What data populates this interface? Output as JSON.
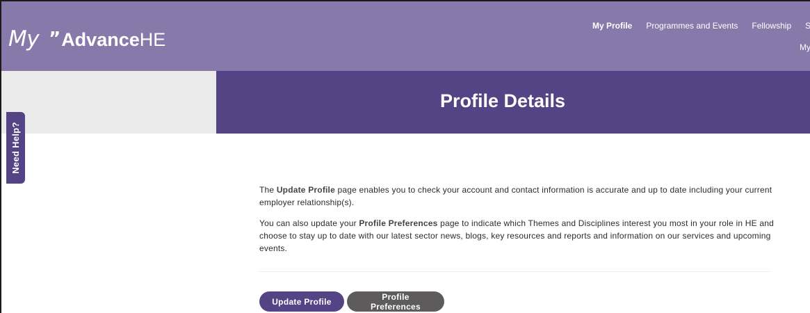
{
  "header": {
    "logo": {
      "my": "My",
      "quote": "”",
      "advance": "Advance",
      "he": "HE"
    },
    "nav": [
      {
        "label": "My Profile",
        "active": true
      },
      {
        "label": "Programmes and Events",
        "active": false
      },
      {
        "label": "Fellowship",
        "active": false
      },
      {
        "label": "S",
        "active": false
      }
    ],
    "nav_second_row": "My"
  },
  "banner": {
    "title": "Profile Details"
  },
  "help_tab": {
    "label": "Need Help?"
  },
  "content": {
    "p1": {
      "before": "The ",
      "bold": "Update Profile",
      "after": " page enables you to check your account and contact information is accurate and up to date including your current employer relationship(s)."
    },
    "p2": {
      "before": "You can also update your ",
      "bold": "Profile Preferences",
      "after": " page to indicate which Themes and Disciplines interest you most in your role in HE and choose to stay up to date with our latest sector news, blogs, key resources and reports and information on our services and upcoming events."
    }
  },
  "buttons": {
    "update_profile": "Update Profile",
    "profile_preferences": "Profile Preferences"
  },
  "colors": {
    "header_bg": "#877aab",
    "banner_bg": "#544485",
    "primary_button": "#544485",
    "secondary_button": "#5d5b5c",
    "side_panel": "#ebebeb"
  }
}
